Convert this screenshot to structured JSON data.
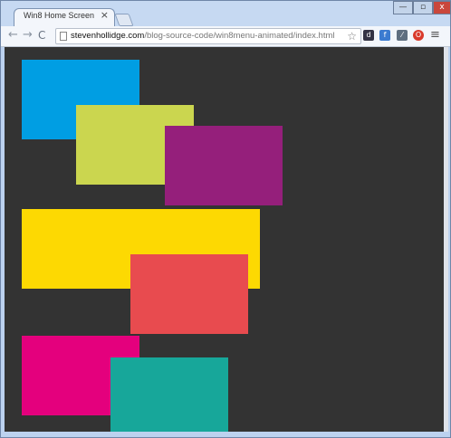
{
  "browser": {
    "tab_title": "Win8 Home Screen",
    "tab_close_label": "×",
    "url_domain": "stevenhollidge.com",
    "url_path": "/blog-source-code/win8menu-animated/index.html",
    "window_controls": {
      "minimize": "—",
      "maximize": "▫",
      "close": "x"
    },
    "toolbar_icons": {
      "back": "←",
      "forward": "→",
      "reload": "C",
      "star": "☆",
      "menu": "≡"
    },
    "extension_labels": [
      "d",
      "f",
      "⁄",
      "O"
    ]
  },
  "tiles": [
    {
      "name": "tile-blue",
      "color": "#009ee3"
    },
    {
      "name": "tile-lime",
      "color": "#cbd64f"
    },
    {
      "name": "tile-purple",
      "color": "#951f7b"
    },
    {
      "name": "tile-yellow",
      "color": "#fdd902"
    },
    {
      "name": "tile-red",
      "color": "#e84b4f"
    },
    {
      "name": "tile-pink",
      "color": "#e4007d"
    },
    {
      "name": "tile-teal",
      "color": "#17a79a"
    }
  ],
  "colors": {
    "viewport_bg": "#333333",
    "close_button": "#c9473c"
  }
}
